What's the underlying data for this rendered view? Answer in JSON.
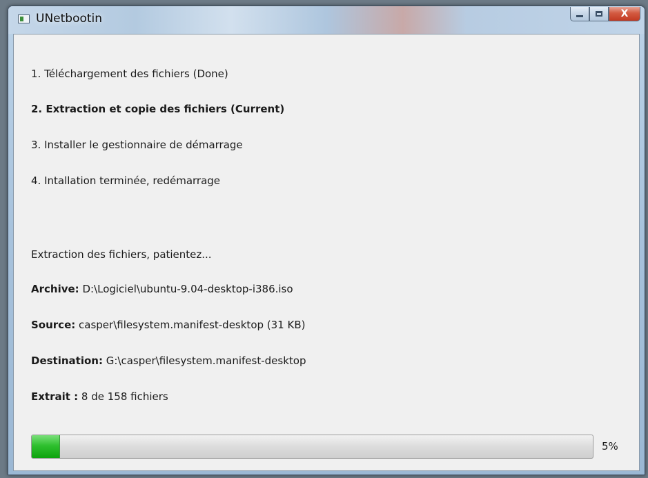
{
  "window": {
    "title": "UNetbootin",
    "icon": "app-icon"
  },
  "caption_buttons": {
    "minimize_icon": "minimize-icon",
    "maximize_icon": "maximize-icon",
    "close_label": "X"
  },
  "steps": [
    {
      "label": "1. Téléchargement des fichiers (Done)",
      "current": false
    },
    {
      "label": "2. Extraction et copie des fichiers (Current)",
      "current": true
    },
    {
      "label": "3. Installer le gestionnaire de démarrage",
      "current": false
    },
    {
      "label": "4. Intallation terminée, redémarrage",
      "current": false
    }
  ],
  "status": {
    "message": "Extraction des fichiers, patientez...",
    "archive_label": "Archive:",
    "archive_value": " D:\\Logiciel\\ubuntu-9.04-desktop-i386.iso",
    "source_label": "Source:",
    "source_value": " casper\\filesystem.manifest-desktop (31 KB)",
    "destination_label": "Destination:",
    "destination_value": " G:\\casper\\filesystem.manifest-desktop",
    "extracted_label": "Extrait :",
    "extracted_value": " 8 de 158 fichiers"
  },
  "progress": {
    "percent": 5,
    "label": "5%"
  },
  "colors": {
    "progress_fill": "#2fc02f",
    "close_button": "#c23a22",
    "titlebar": "#b3cae0"
  }
}
